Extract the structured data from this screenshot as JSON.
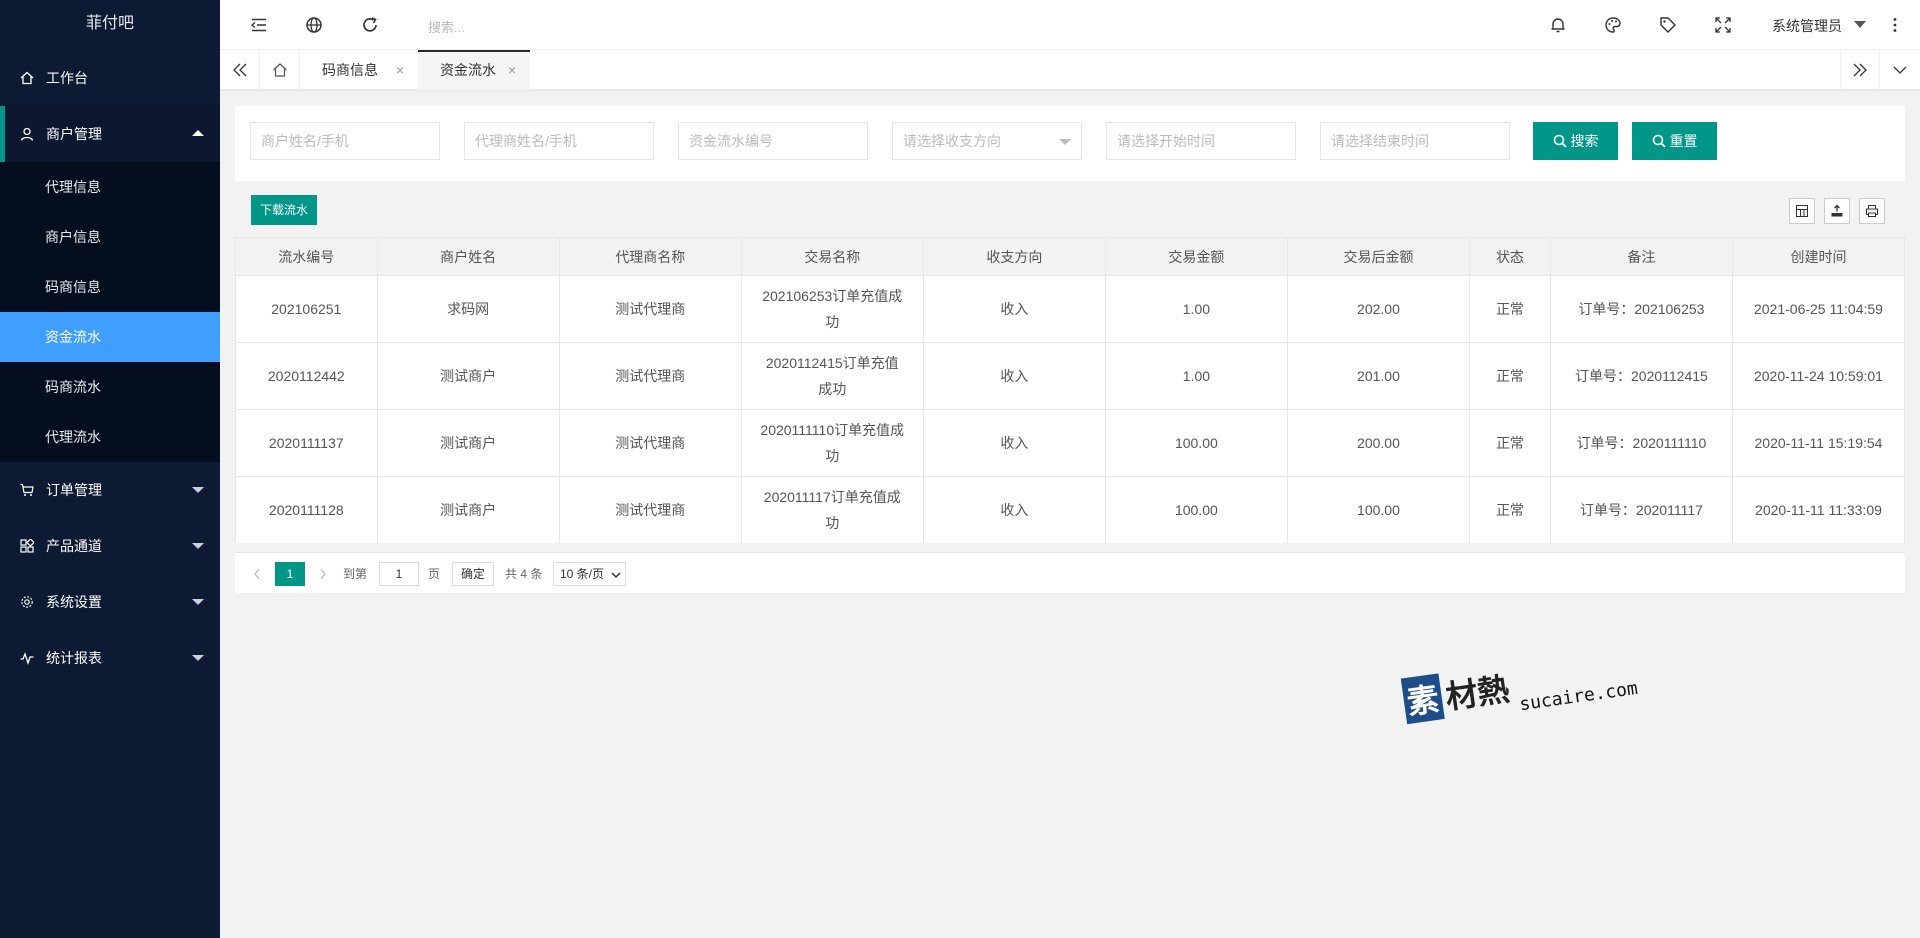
{
  "app": {
    "title": "菲付吧"
  },
  "sidebar": {
    "workbench": "工作台",
    "merchant_mgmt": "商户管理",
    "sub_items": [
      "代理信息",
      "商户信息",
      "码商信息",
      "资金流水",
      "码商流水",
      "代理流水"
    ],
    "order_mgmt": "订单管理",
    "product_channel": "产品通道",
    "system_settings": "系统设置",
    "stat_report": "统计报表"
  },
  "header": {
    "search_placeholder": "搜索...",
    "user": "系统管理员"
  },
  "tabs": [
    {
      "label": "码商信息"
    },
    {
      "label": "资金流水"
    }
  ],
  "filters": {
    "merchant_placeholder": "商户姓名/手机",
    "agent_placeholder": "代理商姓名/手机",
    "flow_no_placeholder": "资金流水编号",
    "direction_placeholder": "请选择收支方向",
    "start_placeholder": "请选择开始时间",
    "end_placeholder": "请选择结束时间",
    "search_btn": "搜索",
    "reset_btn": "重置"
  },
  "toolbar": {
    "download_label": "下载流水"
  },
  "table": {
    "columns": [
      "流水编号",
      "商户姓名",
      "代理商名称",
      "交易名称",
      "收支方向",
      "交易金额",
      "交易后金额",
      "状态",
      "备注",
      "创建时间"
    ],
    "rows": [
      [
        "202106251",
        "求码网",
        "测试代理商",
        "202106253订单充值成功",
        "收入",
        "1.00",
        "202.00",
        "正常",
        "订单号：202106253",
        "2021-06-25 11:04:59"
      ],
      [
        "2020112442",
        "测试商户",
        "测试代理商",
        "2020112415订单充值成功",
        "收入",
        "1.00",
        "201.00",
        "正常",
        "订单号：2020112415",
        "2020-11-24 10:59:01"
      ],
      [
        "2020111137",
        "测试商户",
        "测试代理商",
        "2020111110订单充值成功",
        "收入",
        "100.00",
        "200.00",
        "正常",
        "订单号：2020111110",
        "2020-11-11 15:19:54"
      ],
      [
        "2020111128",
        "测试商户",
        "测试代理商",
        "202011117订单充值成功",
        "收入",
        "100.00",
        "100.00",
        "正常",
        "订单号：202011117",
        "2020-11-11 11:33:09"
      ]
    ]
  },
  "pagination": {
    "current": "1",
    "goto_label": "到第",
    "goto_value": "1",
    "page_unit": "页",
    "confirm": "确定",
    "total": "共 4 条",
    "page_size": "10 条/页"
  },
  "watermark": {
    "text": "素材熱",
    "domain": "sucaire.com"
  },
  "colors": {
    "sidebar_bg": "#0c1a33",
    "accent": "#009688",
    "active_item": "#409eff"
  }
}
